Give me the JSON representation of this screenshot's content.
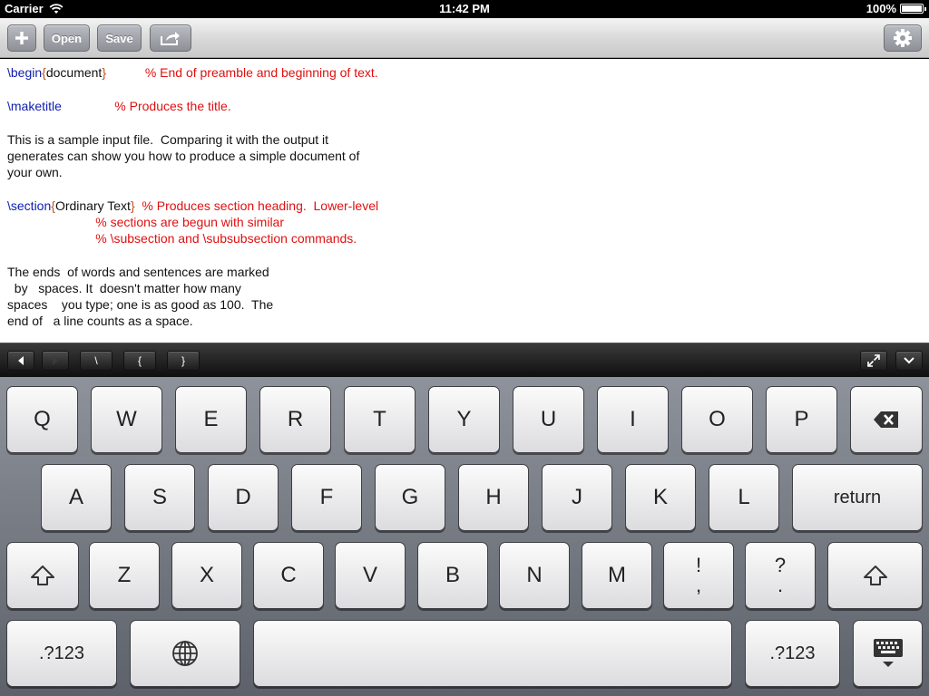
{
  "status_bar": {
    "carrier": "Carrier",
    "time": "11:42 PM",
    "battery": "100%"
  },
  "toolbar": {
    "open_label": "Open",
    "save_label": "Save"
  },
  "editor": {
    "lines": [
      {
        "cmd": "\\begin",
        "open": "{",
        "arg": "document",
        "close": "}",
        "pad": "           ",
        "comment": "% End of preamble and beginning of text."
      },
      {
        "cmd": "\\maketitle",
        "pad": "               ",
        "comment": "% Produces the title."
      },
      {
        "text": "This is a sample input file.  Comparing it with the output it"
      },
      {
        "text": "generates can show you how to produce a simple document of"
      },
      {
        "text": "your own."
      },
      {
        "cmd": "\\section",
        "open": "{",
        "arg": "Ordinary Text",
        "close": "}",
        "pad": "  ",
        "comment": "% Produces section heading.  Lower-level"
      },
      {
        "indent": "                         ",
        "comment": "% sections are begun with similar"
      },
      {
        "indent": "                         ",
        "comment": "% \\subsection and \\subsubsection commands."
      },
      {
        "text": "The ends  of words and sentences are marked"
      },
      {
        "text": "  by   spaces. It  doesn't matter how many"
      },
      {
        "text": "spaces    you type; one is as good as 100.  The"
      },
      {
        "text": "end of   a line counts as a space."
      }
    ]
  },
  "accessory_bar": {
    "backslash": "\\",
    "open_brace": "{",
    "close_brace": "}"
  },
  "keyboard": {
    "row1": [
      "Q",
      "W",
      "E",
      "R",
      "T",
      "Y",
      "U",
      "I",
      "O",
      "P"
    ],
    "row2": [
      "A",
      "S",
      "D",
      "F",
      "G",
      "H",
      "J",
      "K",
      "L"
    ],
    "return_label": "return",
    "row3": [
      "Z",
      "X",
      "C",
      "V",
      "B",
      "N",
      "M"
    ],
    "exclaim_top": "!",
    "exclaim_bottom": ",",
    "question_top": "?",
    "question_bottom": ".",
    "numbers_label": ".?123"
  },
  "icons": [
    "wifi-icon",
    "battery-icon",
    "plus-icon",
    "share-icon",
    "gear-icon",
    "left-arrow-icon",
    "right-arrow-icon",
    "expand-icon",
    "chevron-down-icon",
    "backspace-icon",
    "shift-icon",
    "globe-icon",
    "keyboard-hide-icon"
  ]
}
